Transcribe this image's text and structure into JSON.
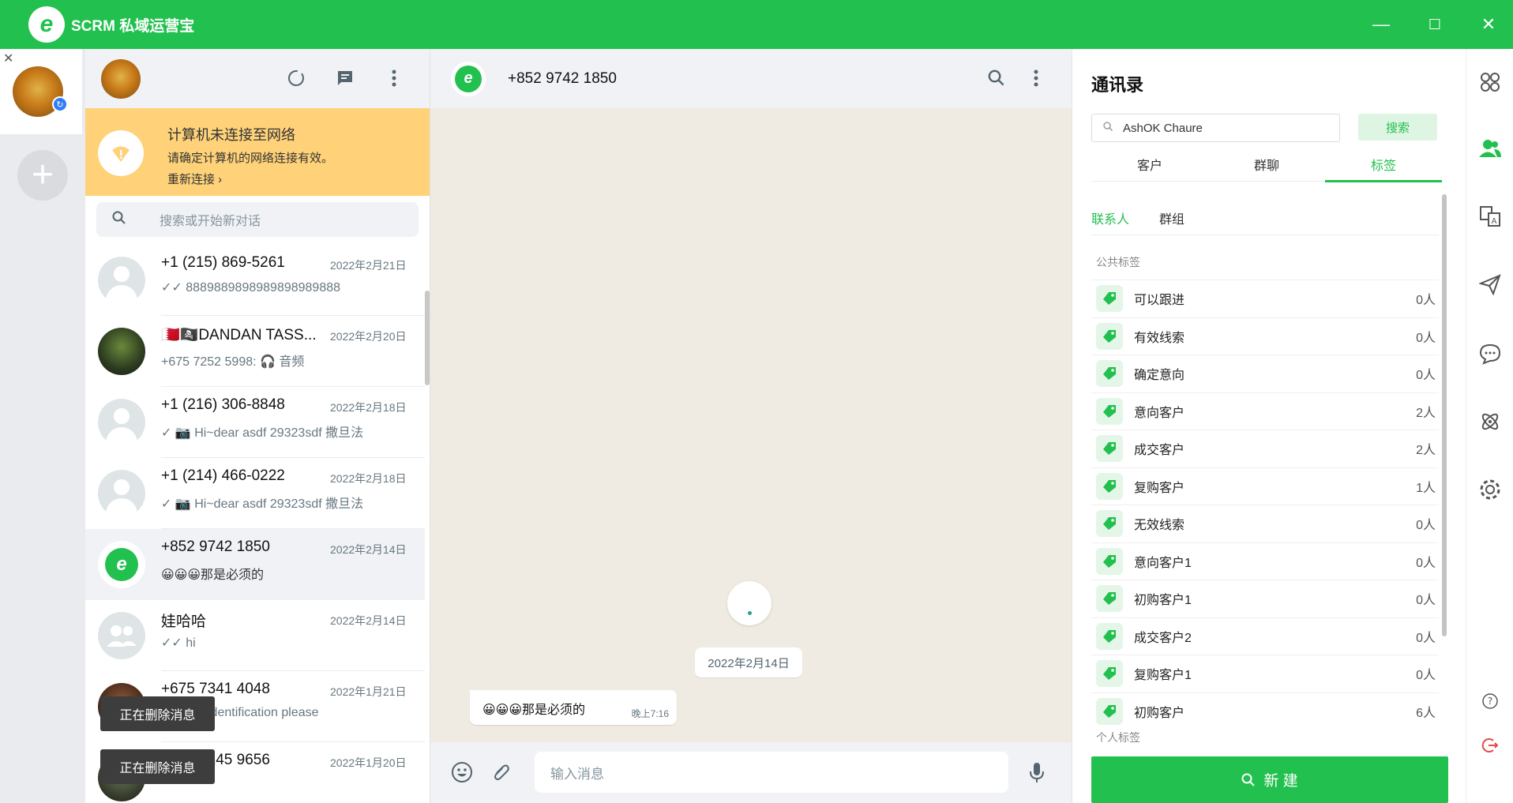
{
  "app": {
    "title": "SCRM 私域运营宝",
    "logo_letter": "e",
    "controls": {
      "minimize": "—",
      "maximize": "☐",
      "close": "✕"
    }
  },
  "accounts": {
    "close": "✕",
    "add": "+"
  },
  "notice": {
    "title": "计算机未连接至网络",
    "desc": "请确定计算机的网络连接有效。",
    "action": "重新连接 ›"
  },
  "search": {
    "placeholder": "搜索或开始新对话"
  },
  "chats": [
    {
      "name": "+1 (215) 869-5261",
      "date": "2022年2月21日",
      "msg": "✓✓ 8889889898989898989888",
      "avatar": "default"
    },
    {
      "name": "🇧🇭🏴‍☠️DANDAN TASS...",
      "date": "2022年2月20日",
      "msg": "+675 7252 5998: 🎧 音频",
      "avatar": "photo"
    },
    {
      "name": "+1 (216) 306-8848",
      "date": "2022年2月18日",
      "msg": "✓ 📷 Hi~dear asdf 29323sdf 撒旦法",
      "avatar": "default"
    },
    {
      "name": "+1 (214) 466-0222",
      "date": "2022年2月18日",
      "msg": "✓ 📷 Hi~dear asdf 29323sdf 撒旦法",
      "avatar": "default"
    },
    {
      "name": "+852 9742 1850",
      "date": "2022年2月14日",
      "msg": "😀😀😀那是必须的",
      "avatar": "logo"
    },
    {
      "name": "娃哈哈",
      "date": "2022年2月14日",
      "msg": "✓✓ hi",
      "avatar": "group"
    },
    {
      "name": "+675 7341 4048",
      "date": "2022年1月21日",
      "msg": "identification please",
      "avatar": "photo2"
    },
    {
      "name": "+675 7145 9656",
      "date": "2022年1月20日",
      "msg": "",
      "avatar": "photo3"
    }
  ],
  "toasts": [
    "正在删除消息",
    "正在删除消息"
  ],
  "conversation": {
    "name": "+852 9742 1850",
    "date_chip": "2022年2月14日",
    "message": {
      "text": "😀😀😀那是必须的",
      "time": "晚上7:16"
    },
    "composer_placeholder": "输入消息"
  },
  "contacts": {
    "title": "通讯录",
    "search_value": "AshOK Chaure",
    "search_button": "搜索",
    "tabs": [
      "客户",
      "群聊",
      "标签"
    ],
    "active_tab": 2,
    "subtabs": [
      "联系人",
      "群组"
    ],
    "public_label": "公共标签",
    "private_label": "个人标签",
    "tags": [
      {
        "name": "可以跟进",
        "count": "0人"
      },
      {
        "name": "有效线索",
        "count": "0人"
      },
      {
        "name": "确定意向",
        "count": "0人"
      },
      {
        "name": "意向客户",
        "count": "2人"
      },
      {
        "name": "成交客户",
        "count": "2人"
      },
      {
        "name": "复购客户",
        "count": "1人"
      },
      {
        "name": "无效线索",
        "count": "0人"
      },
      {
        "name": "意向客户1",
        "count": "0人"
      },
      {
        "name": "初购客户1",
        "count": "0人"
      },
      {
        "name": "成交客户2",
        "count": "0人"
      },
      {
        "name": "复购客户1",
        "count": "0人"
      },
      {
        "name": "初购客户",
        "count": "6人"
      }
    ],
    "new_button": "新 建"
  },
  "colors": {
    "brand": "#22c04e",
    "notice": "#ffd279"
  }
}
